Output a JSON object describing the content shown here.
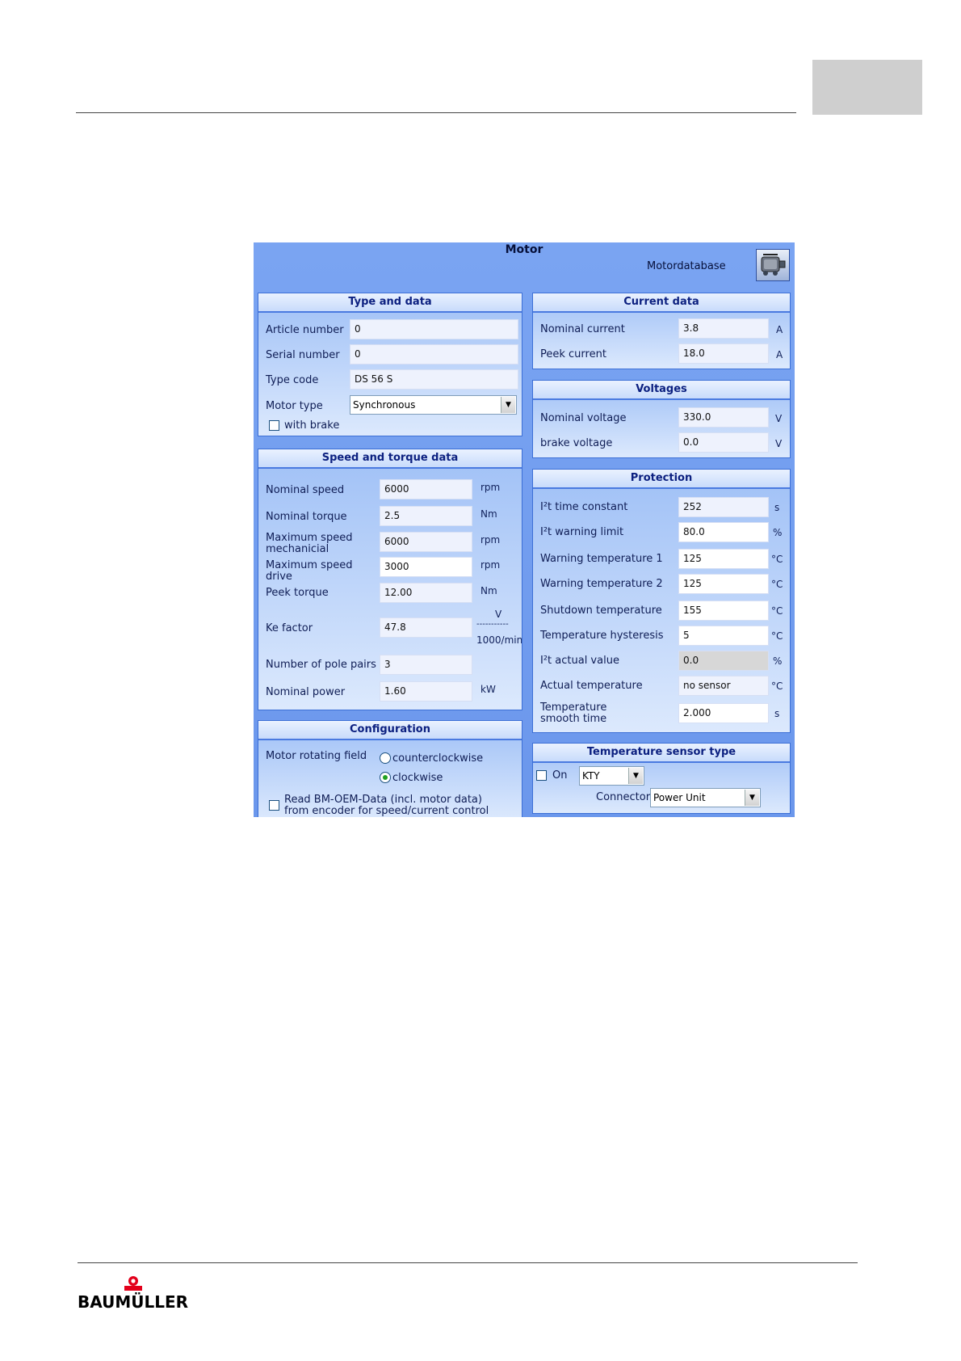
{
  "window": {
    "title": "Motor",
    "motor_database_label": "Motordatabase",
    "database_icon": "motor-database-icon"
  },
  "type_and_data": {
    "heading": "Type and data",
    "article_number": {
      "label": "Article number",
      "value": "0"
    },
    "serial_number": {
      "label": "Serial number",
      "value": "0"
    },
    "type_code": {
      "label": "Type code",
      "value": "DS 56 S"
    },
    "motor_type": {
      "label": "Motor type",
      "value": "Synchronous"
    },
    "with_brake": {
      "label": "with brake",
      "checked": false
    }
  },
  "speed_torque": {
    "heading": "Speed and torque data",
    "nominal_speed": {
      "label": "Nominal speed",
      "value": "6000",
      "unit": "rpm"
    },
    "nominal_torque": {
      "label": "Nominal torque",
      "value": "2.5",
      "unit": "Nm"
    },
    "max_speed_mech": {
      "label1": "Maximum speed",
      "label2": "mechanicial",
      "value": "6000",
      "unit": "rpm"
    },
    "max_speed_drive": {
      "label1": "Maximum speed",
      "label2": "drive",
      "value": "3000",
      "unit": "rpm"
    },
    "peek_torque": {
      "label": "Peek torque",
      "value": "12.00",
      "unit": "Nm"
    },
    "ke_factor": {
      "label": "Ke factor",
      "value": "47.8",
      "unit_top": "V",
      "unit_line": "-----------",
      "unit_bottom": "1000/min"
    },
    "pole_pairs": {
      "label": "Number of pole pairs",
      "value": "3"
    },
    "nominal_power": {
      "label": "Nominal power",
      "value": "1.60",
      "unit": "kW"
    }
  },
  "configuration": {
    "heading": "Configuration",
    "rotating_field_label": "Motor rotating field",
    "option_ccw": "counterclockwise",
    "option_cw": "clockwise",
    "selected": "clockwise",
    "oem_line1": "Read BM-OEM-Data (incl. motor data)",
    "oem_line2": "from encoder for speed/current control",
    "oem_checked": false
  },
  "current_data": {
    "heading": "Current data",
    "nominal_current": {
      "label": "Nominal current",
      "value": "3.8",
      "unit": "A"
    },
    "peek_current": {
      "label": "Peek current",
      "value": "18.0",
      "unit": "A"
    }
  },
  "voltages": {
    "heading": "Voltages",
    "nominal_voltage": {
      "label": "Nominal voltage",
      "value": "330.0",
      "unit": "V"
    },
    "brake_voltage": {
      "label": "brake voltage",
      "value": "0.0",
      "unit": "V"
    }
  },
  "protection": {
    "heading": "Protection",
    "i2t_time_constant": {
      "label": "I²t time constant",
      "value": "252",
      "unit": "s"
    },
    "i2t_warning_limit": {
      "label": "I²t warning limit",
      "value": "80.0",
      "unit": "%"
    },
    "warning_temp_1": {
      "label": "Warning temperature 1",
      "value": "125",
      "unit": "°C"
    },
    "warning_temp_2": {
      "label": "Warning temperature 2",
      "value": "125",
      "unit": "°C"
    },
    "shutdown_temp": {
      "label": "Shutdown temperature",
      "value": "155",
      "unit": "°C"
    },
    "temp_hysteresis": {
      "label": "Temperature hysteresis",
      "value": "5",
      "unit": "°C"
    },
    "i2t_actual": {
      "label": "I²t actual value",
      "value": "0.0",
      "unit": "%"
    },
    "actual_temp": {
      "label": "Actual temperature",
      "value": "no sensor",
      "unit": "°C"
    },
    "temp_smooth": {
      "label1": "Temperature",
      "label2": "smooth time",
      "value": "2.000",
      "unit": "s"
    }
  },
  "temp_sensor": {
    "heading": "Temperature sensor type",
    "on_label": "On",
    "on_checked": false,
    "sensor_type": "KTY",
    "connector_label": "Connector",
    "connector_value": "Power Unit"
  },
  "footer": {
    "brand": "BAUMÜLLER"
  },
  "colors": {
    "window_bg": "#7aa4f2",
    "panel_border": "#3c6fd6",
    "heading_text": "#0c2080"
  }
}
